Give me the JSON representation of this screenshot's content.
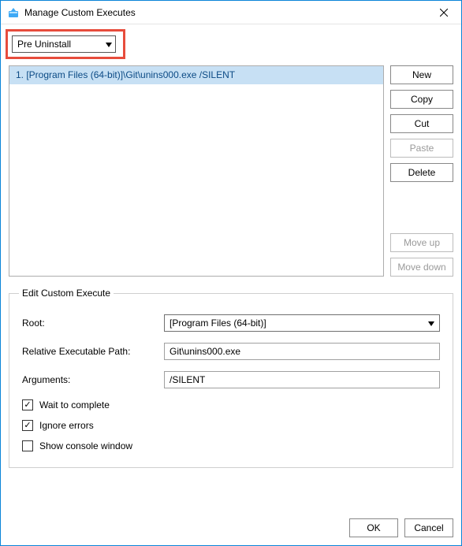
{
  "window": {
    "title": "Manage Custom Executes"
  },
  "stage_dropdown": {
    "selected": "Pre Uninstall"
  },
  "executes_list": {
    "items": [
      {
        "label": "1. [Program Files (64-bit)]\\Git\\unins000.exe /SILENT"
      }
    ]
  },
  "buttons": {
    "new": "New",
    "copy": "Copy",
    "cut": "Cut",
    "paste": "Paste",
    "delete": "Delete",
    "move_up": "Move up",
    "move_down": "Move down",
    "ok": "OK",
    "cancel": "Cancel"
  },
  "edit_group": {
    "legend": "Edit Custom Execute",
    "root_label": "Root:",
    "root_value": "[Program Files (64-bit)]",
    "relpath_label": "Relative Executable Path:",
    "relpath_value": "Git\\unins000.exe",
    "args_label": "Arguments:",
    "args_value": "/SILENT",
    "wait_label": "Wait to complete",
    "wait_checked": true,
    "ignore_label": "Ignore errors",
    "ignore_checked": true,
    "console_label": "Show console window",
    "console_checked": false
  }
}
